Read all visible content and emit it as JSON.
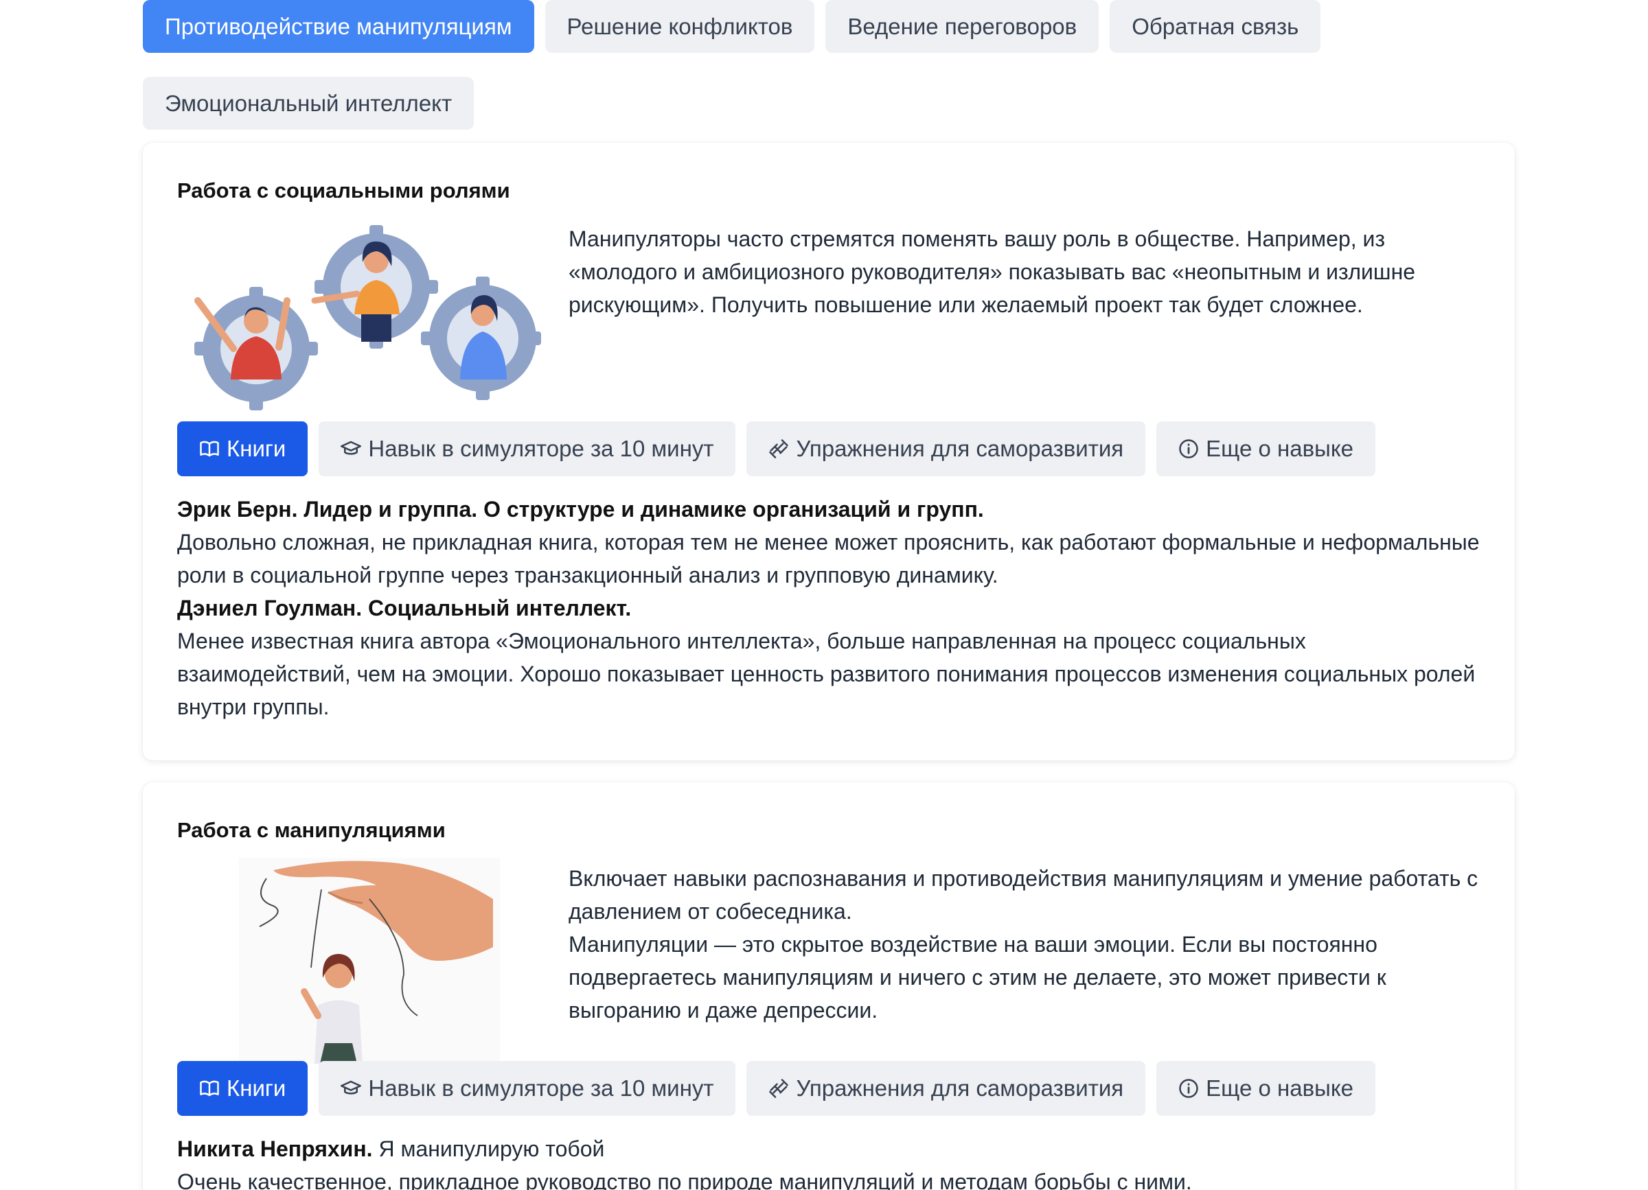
{
  "tabs": [
    {
      "label": "Противодействие манипуляциям",
      "active": true
    },
    {
      "label": "Решение конфликтов",
      "active": false
    },
    {
      "label": "Ведение переговоров",
      "active": false
    },
    {
      "label": "Обратная связь",
      "active": false
    },
    {
      "label": "Эмоциональный интеллект",
      "active": false
    }
  ],
  "buttons": {
    "books": "Книги",
    "simulator": "Навык в симуляторе за 10 минут",
    "exercises": "Упражнения для саморазвития",
    "more": "Еще о навыке"
  },
  "cards": [
    {
      "title": "Работа с социальными ролями",
      "description": [
        "Манипуляторы часто стремятся поменять вашу роль в обществе. Например, из «молодого и амбициозного руководителя» показывать вас «неопытным и излишне рискующим». Получить повышение или желаемый проект так будет сложнее."
      ],
      "books": [
        {
          "title": "Эрик Берн. Лидер и группа. О структуре и динамике организаций и групп.",
          "text": "Довольно сложная, не прикладная книга, которая тем не менее может прояснить, как работают формальные и неформальные роли в социальной группе через транзакционный анализ и групповую динамику."
        },
        {
          "title": "Дэниел Гоулман. Социальный интеллект.",
          "text": "Менее известная книга автора «Эмоционального интеллекта», больше направленная на процесс социальных взаимодействий, чем на эмоции. Хорошо показывает ценность развитого понимания процессов изменения социальных ролей внутри группы."
        }
      ]
    },
    {
      "title": "Работа с манипуляциями",
      "description": [
        "Включает навыки распознавания и противодействия манипуляциям и умение работать с давлением от собеседника.",
        "Манипуляции — это скрытое воздействие на ваши эмоции. Если вы постоянно подвергаетесь манипуляциям и ничего с этим не делаете, это может привести к выгоранию и даже депрессии."
      ],
      "books": [
        {
          "title": "Никита Непряхин.",
          "inline": " Я манипулирую тобой",
          "text": "Очень качественное, прикладное руководство по природе манипуляций и методам борьбы с ними."
        }
      ]
    }
  ],
  "colors": {
    "accent_tab": "#4285f4",
    "accent_button": "#1a5ae6",
    "neutral_bg": "#eef0f3"
  }
}
